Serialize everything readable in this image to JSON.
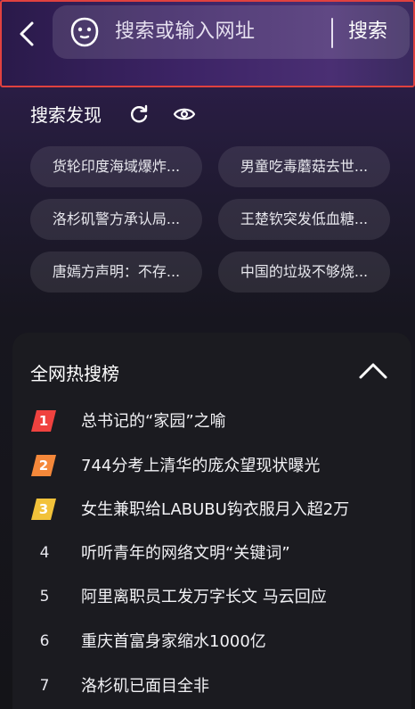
{
  "search": {
    "placeholder": "搜索或输入网址",
    "button_label": "搜索"
  },
  "discover": {
    "title": "搜索发现",
    "chips": [
      "货轮印度海域爆炸...",
      "男童吃毒蘑菇去世...",
      "洛杉矶警方承认局...",
      "王楚钦突发低血糖...",
      "唐嫣方声明：不存...",
      "中国的垃圾不够烧..."
    ]
  },
  "hot_list": {
    "title": "全网热搜榜",
    "items": [
      {
        "rank": "1",
        "text": "总书记的“家园”之喻",
        "badge_color": "#f0423f"
      },
      {
        "rank": "2",
        "text": "744分考上清华的庞众望现状曝光",
        "badge_color": "#f5883a"
      },
      {
        "rank": "3",
        "text": "女生兼职给LABUBU钩衣服月入超2万",
        "badge_color": "#f2c23a"
      },
      {
        "rank": "4",
        "text": "听听青年的网络文明“关键词”"
      },
      {
        "rank": "5",
        "text": "阿里离职员工发万字长文 马云回应"
      },
      {
        "rank": "6",
        "text": "重庆首富身家缩水1000亿"
      },
      {
        "rank": "7",
        "text": "洛杉矶已面目全非"
      }
    ]
  },
  "colors": {
    "highlight_border": "#e0413f"
  }
}
